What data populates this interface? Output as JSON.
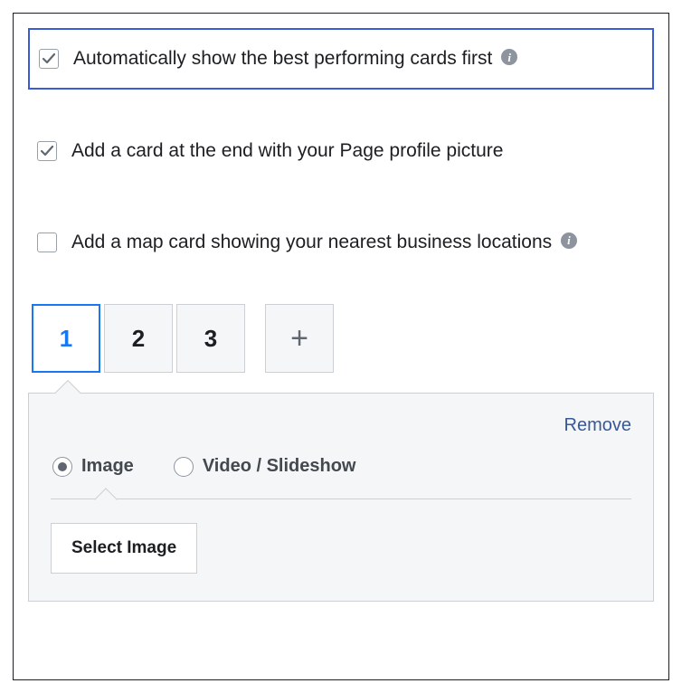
{
  "options": {
    "auto_best_first": {
      "label": "Automatically show the best performing cards first",
      "checked": true,
      "has_info": true
    },
    "end_card_profile": {
      "label": "Add a card at the end with your Page profile picture",
      "checked": true,
      "has_info": false
    },
    "map_card": {
      "label": "Add a map card showing your nearest business locations",
      "checked": false,
      "has_info": true
    }
  },
  "cards": {
    "tabs": [
      "1",
      "2",
      "3"
    ],
    "active_index": 0,
    "add_symbol": "+"
  },
  "panel": {
    "remove_label": "Remove",
    "media_type_options": {
      "image": "Image",
      "video_slideshow": "Video / Slideshow"
    },
    "selected_media_type": "image",
    "select_image_button": "Select Image"
  }
}
